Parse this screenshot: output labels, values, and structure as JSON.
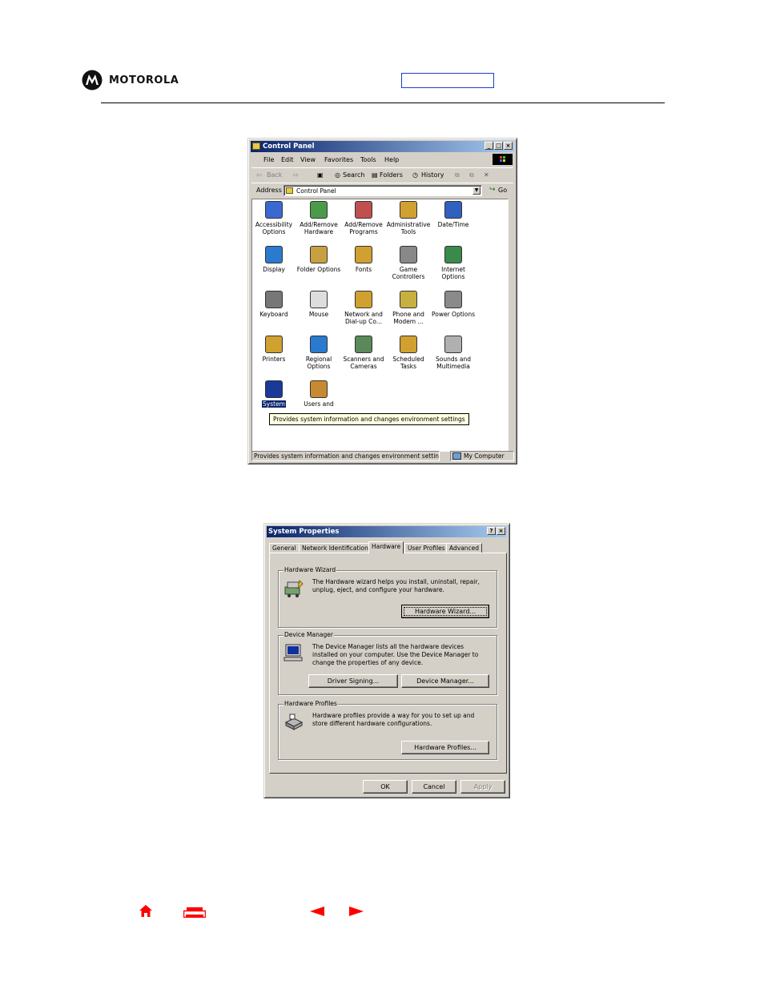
{
  "header": {
    "brand": "MOTOROLA"
  },
  "control_panel": {
    "title": "Control Panel",
    "menu": [
      "File",
      "Edit",
      "View",
      "Favorites",
      "Tools",
      "Help"
    ],
    "toolbar": {
      "back": "Back",
      "search": "Search",
      "folders": "Folders",
      "history": "History"
    },
    "address_label": "Address",
    "address_value": "Control Panel",
    "go": "Go",
    "items": [
      {
        "label": "Accessibility Options",
        "icon": "accessibility-icon"
      },
      {
        "label": "Add/Remove Hardware",
        "icon": "add-remove-hardware-icon"
      },
      {
        "label": "Add/Remove Programs",
        "icon": "add-remove-programs-icon"
      },
      {
        "label": "Administrative Tools",
        "icon": "administrative-tools-icon"
      },
      {
        "label": "Date/Time",
        "icon": "date-time-icon"
      },
      {
        "label": "Display",
        "icon": "display-icon"
      },
      {
        "label": "Folder Options",
        "icon": "folder-options-icon"
      },
      {
        "label": "Fonts",
        "icon": "fonts-icon"
      },
      {
        "label": "Game Controllers",
        "icon": "game-controllers-icon"
      },
      {
        "label": "Internet Options",
        "icon": "internet-options-icon"
      },
      {
        "label": "Keyboard",
        "icon": "keyboard-icon"
      },
      {
        "label": "Mouse",
        "icon": "mouse-icon"
      },
      {
        "label": "Network and Dial-up Co...",
        "icon": "network-icon"
      },
      {
        "label": "Phone and Modem ...",
        "icon": "phone-modem-icon"
      },
      {
        "label": "Power Options",
        "icon": "power-options-icon"
      },
      {
        "label": "Printers",
        "icon": "printers-icon"
      },
      {
        "label": "Regional Options",
        "icon": "regional-options-icon"
      },
      {
        "label": "Scanners and Cameras",
        "icon": "scanners-icon"
      },
      {
        "label": "Scheduled Tasks",
        "icon": "scheduled-tasks-icon"
      },
      {
        "label": "Sounds and Multimedia",
        "icon": "sounds-icon"
      },
      {
        "label": "System",
        "icon": "system-icon"
      },
      {
        "label": "Users and",
        "icon": "users-icon"
      }
    ],
    "tooltip": "Provides system information and changes environment settings",
    "status_text": "Provides system information and changes environment settings",
    "status_zone": "My Computer"
  },
  "system_properties": {
    "title": "System Properties",
    "tabs": [
      "General",
      "Network Identification",
      "Hardware",
      "User Profiles",
      "Advanced"
    ],
    "selected_tab": "Hardware",
    "hardware_wizard": {
      "legend": "Hardware Wizard",
      "desc": "The Hardware wizard helps you install, uninstall, repair, unplug, eject, and configure your hardware.",
      "button": "Hardware Wizard..."
    },
    "device_manager": {
      "legend": "Device Manager",
      "desc": "The Device Manager lists all the hardware devices installed on your computer. Use the Device Manager to change the properties of any device.",
      "driver_button": "Driver Signing...",
      "device_button": "Device Manager..."
    },
    "hardware_profiles": {
      "legend": "Hardware Profiles",
      "desc": "Hardware profiles provide a way for you to set up and store different hardware configurations.",
      "button": "Hardware Profiles..."
    },
    "ok": "OK",
    "cancel": "Cancel",
    "apply": "Apply"
  },
  "colors": {
    "nav_red": "#ff0000",
    "titlebar": "#0a246a",
    "selection": "#0a246a"
  }
}
